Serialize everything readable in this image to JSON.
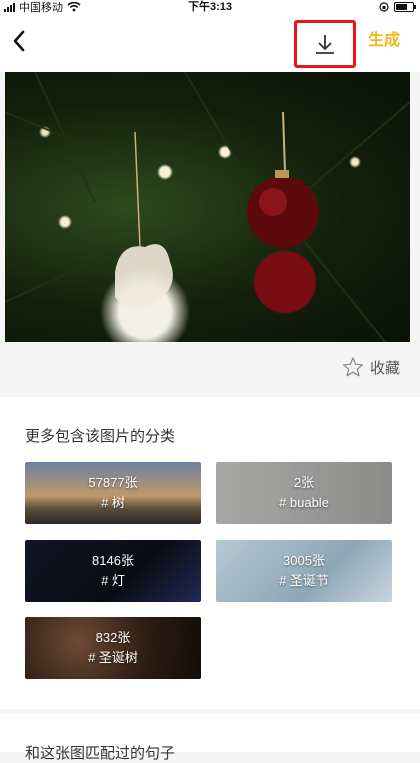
{
  "status_bar": {
    "carrier": "中国移动",
    "time": "下午3:13"
  },
  "nav": {
    "back_icon": "chevron-left-icon",
    "download_icon": "download-icon",
    "generate_label": "生成",
    "accent": "#f2b81c",
    "highlight": "#e8151b"
  },
  "hero": {
    "description_icon": "photo"
  },
  "collect": {
    "label": "收藏",
    "icon": "star-outline-icon"
  },
  "categories": {
    "title": "更多包含该图片的分类",
    "items": [
      {
        "count": "57877张",
        "tag": "# 树"
      },
      {
        "count": "2张",
        "tag": "# buable"
      },
      {
        "count": "8146张",
        "tag": "# 灯"
      },
      {
        "count": "3005张",
        "tag": "# 圣诞节"
      },
      {
        "count": "832张",
        "tag": "# 圣诞树"
      }
    ]
  },
  "next_section": {
    "title": "和这张图匹配过的句子"
  }
}
